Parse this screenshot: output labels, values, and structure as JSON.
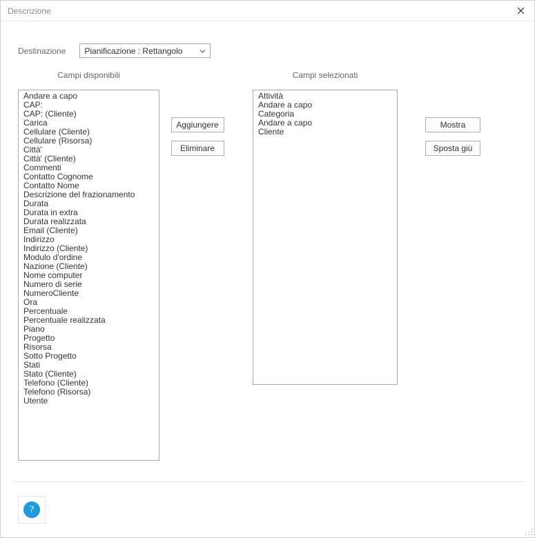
{
  "window": {
    "title": "Descrizione"
  },
  "destination": {
    "label": "Destinazione",
    "selected": "Pianificazione : Rettangolo"
  },
  "headers": {
    "available": "Campi disponibili",
    "selected": "Campi selezionati"
  },
  "buttons": {
    "add": "Aggiungere",
    "remove": "Eliminare",
    "show": "Mostra",
    "movedown": "Sposta giù"
  },
  "available": [
    "Andare a capo",
    "CAP:",
    "CAP:  (Cliente)",
    "Carica",
    "Cellulare (Cliente)",
    "Cellulare (Risorsa)",
    "Città'",
    "Città'  (Cliente)",
    "Commenti",
    "Contatto Cognome",
    "Contatto Nome",
    "Descrizione del frazionamento",
    "Durata",
    "Durata in extra",
    "Durata realizzata",
    "Email (Cliente)",
    "Indirizzo",
    "Indirizzo (Cliente)",
    "Modulo d'ordine",
    "Nazione (Cliente)",
    "Nome computer",
    "Numero di serie",
    "NumeroCliente",
    "Ora",
    "Percentuale",
    "Percentuale realizzata",
    "Piano",
    "Progetto",
    "Risorsa",
    "Sotto Progetto",
    "Stati",
    "Stato (Cliente)",
    "Telefono (Cliente)",
    "Telefono (Risorsa)",
    "Utente"
  ],
  "selected": [
    "Attività",
    "Andare a capo",
    "Categoria",
    "Andare a capo",
    "Cliente"
  ],
  "help": {
    "symbol": "?"
  }
}
